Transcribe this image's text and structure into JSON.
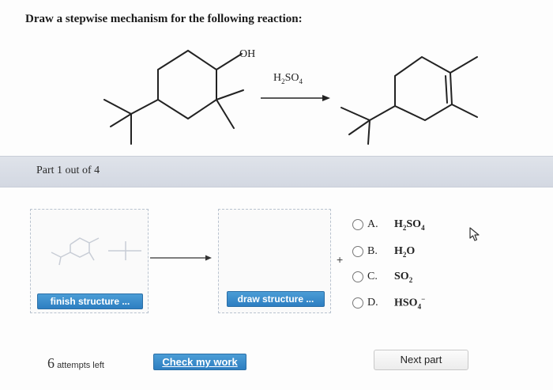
{
  "question": {
    "text": "Draw a stepwise mechanism for the following reaction:"
  },
  "reaction": {
    "oh_label": "OH",
    "reagent": {
      "base": "H",
      "sub1": "2",
      "mid": "SO",
      "sub2": "4"
    }
  },
  "part": {
    "label": "Part 1 out of 4"
  },
  "buttons": {
    "finish": "finish structure ...",
    "draw": "draw structure ...",
    "check": "Check my work",
    "next": "Next part"
  },
  "plus": "+",
  "attempts": {
    "count": "6",
    "label": "attempts left"
  },
  "choices": [
    {
      "letter": "A.",
      "f": "H",
      "s1": "2",
      "m": "SO",
      "s2": "4",
      "sup": ""
    },
    {
      "letter": "B.",
      "f": "H",
      "s1": "2",
      "m": "O",
      "s2": "",
      "sup": ""
    },
    {
      "letter": "C.",
      "f": "SO",
      "s1": "2",
      "m": "",
      "s2": "",
      "sup": ""
    },
    {
      "letter": "D.",
      "f": "HSO",
      "s1": "4",
      "m": "",
      "s2": "",
      "sup": "−"
    }
  ],
  "colors": {
    "button_blue": "#2d7ec1",
    "part_bar": "#d3d8e2",
    "box_dash": "#b9c3cf"
  },
  "icons": [
    "arrow-cursor-icon",
    "reaction-arrow-icon"
  ]
}
